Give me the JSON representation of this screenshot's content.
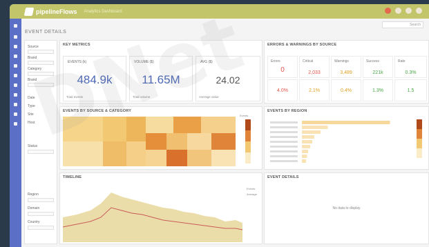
{
  "app": {
    "logo_text": "pipelineFlows",
    "logo_sub": "Analytics Dashboard",
    "page_title": "EVENT DETAILS",
    "search_placeholder": "Search"
  },
  "filters": {
    "items": [
      "Source",
      "Brand",
      "Category",
      "Brand",
      "Date",
      "Type",
      "Site",
      "Host",
      "Status",
      "Region",
      "Domain",
      "Country"
    ]
  },
  "kpi_section": {
    "title": "KEY METRICS"
  },
  "kpis": [
    {
      "label": "EVENTS (k)",
      "value": "484.9k",
      "foot": "Total events"
    },
    {
      "label": "VOLUME ($)",
      "value": "11.65M",
      "foot": "Total volume"
    },
    {
      "label": "AVG ($)",
      "value": "24.02",
      "foot": "Average value"
    }
  ],
  "errors_section": {
    "title": "ERRORS & WARNINGS BY SOURCE"
  },
  "error_tiles": [
    {
      "label": "Errors",
      "value": "0",
      "color": "#e5534b"
    },
    {
      "label": "Critical",
      "value": "2,033",
      "color": "#e5534b"
    },
    {
      "label": "Warnings",
      "value": "3,489",
      "color": "#e0a020"
    },
    {
      "label": "Success",
      "value": "221k",
      "color": "#46a546"
    },
    {
      "label": "Rate",
      "value": "0.3%",
      "color": "#46a546"
    },
    {
      "label": "",
      "value": "4.0%",
      "color": "#e5534b"
    },
    {
      "label": "",
      "value": "2.1%",
      "color": "#e0a020"
    },
    {
      "label": "",
      "value": "0.4%",
      "color": "#e0a020"
    },
    {
      "label": "",
      "value": "1.3%",
      "color": "#46a546"
    },
    {
      "label": "",
      "value": "1.5",
      "color": "#46a546"
    }
  ],
  "heatmap": {
    "title": "EVENTS BY SOURCE & CATEGORY",
    "legend_label": "Events"
  },
  "bars": {
    "title": "EVENTS BY REGION",
    "values": [
      0.85,
      0.25,
      0.18,
      0.12,
      0.1,
      0.08,
      0.06,
      0.05,
      0.04
    ]
  },
  "timeline": {
    "title": "TIMELINE",
    "legend": [
      "Events",
      "Average"
    ]
  },
  "empty_panel": {
    "title": "EVENT DETAILS",
    "message": "No data to display"
  },
  "colors": {
    "topbar": "#c2c56a",
    "nav": "#5b6fc6",
    "accent": "#4a67b8"
  }
}
